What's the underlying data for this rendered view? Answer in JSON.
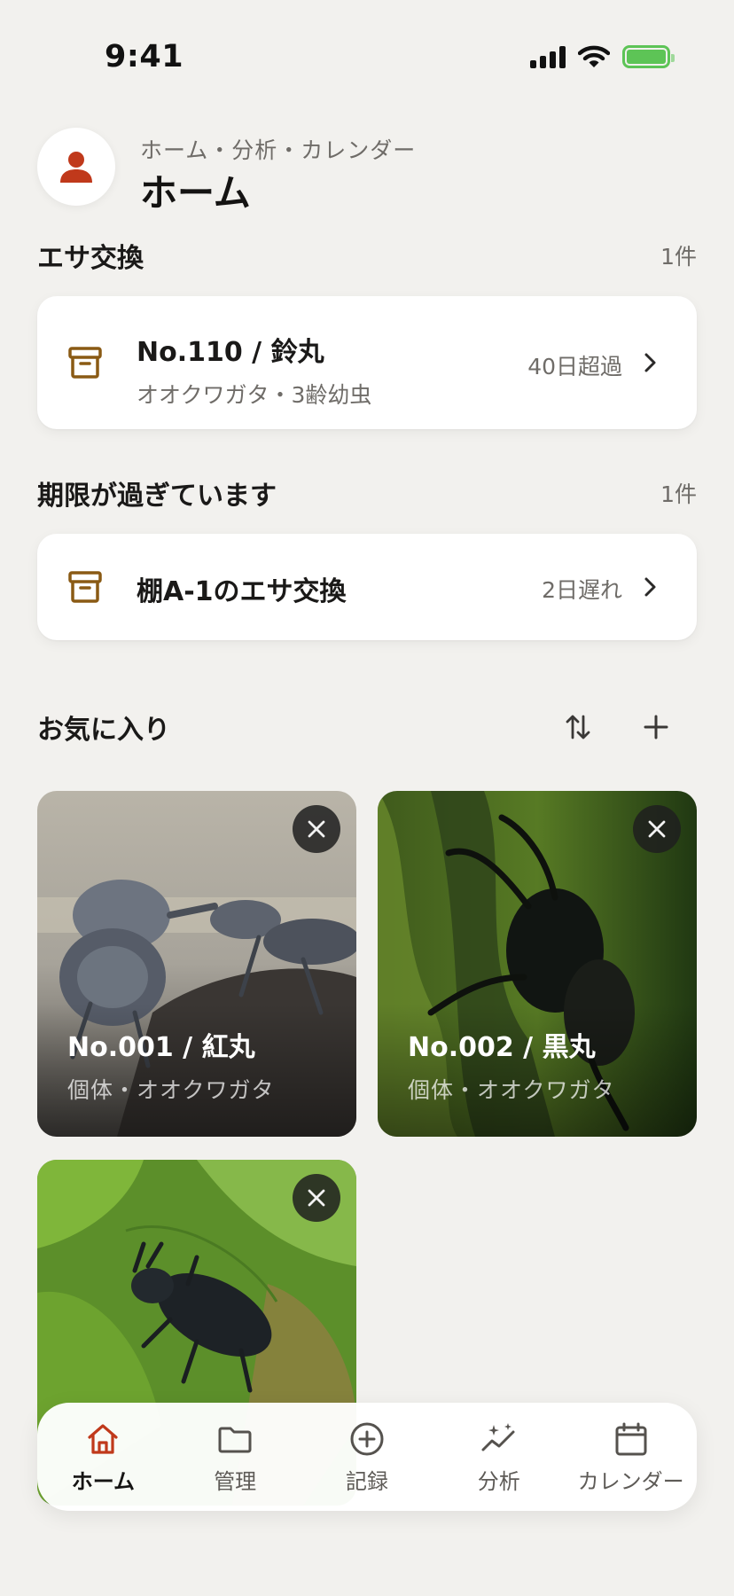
{
  "status_bar": {
    "time": "9:41"
  },
  "header": {
    "breadcrumb": "ホーム・分析・カレンダー",
    "title": "ホーム"
  },
  "sections": {
    "feed_exchange": {
      "title": "エサ交換",
      "count": "1件",
      "item": {
        "title": "No.110 / 鈴丸",
        "subtitle": "オオクワガタ・3齢幼虫",
        "meta": "40日超過"
      }
    },
    "overdue": {
      "title": "期限が過ぎています",
      "count": "1件",
      "item": {
        "title": "棚A-1のエサ交換",
        "meta": "2日遅れ"
      }
    },
    "favorites": {
      "title": "お気に入り",
      "items": [
        {
          "name": "No.001 / 紅丸",
          "subtitle": "個体・オオクワガタ"
        },
        {
          "name": "No.002 / 黒丸",
          "subtitle": "個体・オオクワガタ"
        },
        {
          "name": "",
          "subtitle": ""
        }
      ]
    }
  },
  "tab_bar": {
    "items": [
      {
        "label": "ホーム",
        "icon": "home-icon",
        "active": true
      },
      {
        "label": "管理",
        "icon": "folder-icon"
      },
      {
        "label": "記録",
        "icon": "plus-circle-icon"
      },
      {
        "label": "分析",
        "icon": "sparkle-chart-icon"
      },
      {
        "label": "カレンダー",
        "icon": "calendar-icon"
      }
    ]
  },
  "colors": {
    "accent": "#c0391b",
    "archive_icon": "#8a5a14",
    "background": "#f2f1ee",
    "battery": "#5dc456"
  }
}
